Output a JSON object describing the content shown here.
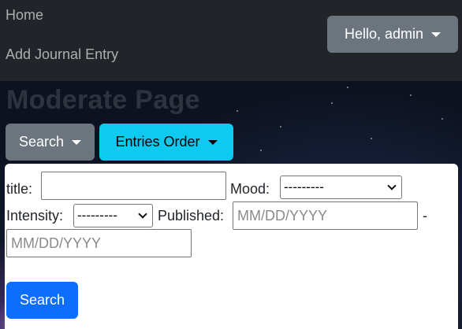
{
  "navbar": {
    "home_label": "Home",
    "add_entry_label": "Add Journal Entry",
    "user_menu_label": "Hello, admin"
  },
  "page": {
    "title": "Moderate Page"
  },
  "toggles": {
    "search_label": "Search",
    "order_label": "Entries Order"
  },
  "search_form": {
    "title_label": "title:",
    "title_value": "",
    "mood_label": "Mood:",
    "mood_selected": "---------",
    "intensity_label": "Intensity:",
    "intensity_selected": "---------",
    "published_label": "Published:",
    "date_from_placeholder": "MM/DD/YYYY",
    "date_separator": "-",
    "date_to_placeholder": "MM/DD/YYYY",
    "submit_label": "Search"
  },
  "colors": {
    "navbar_bg": "#212529",
    "secondary": "#6c757d",
    "info": "#0dcaf0",
    "primary": "#0d6efd"
  },
  "icons": {
    "dropdown": "caret-down-icon",
    "select": "chevron-down-icon"
  }
}
